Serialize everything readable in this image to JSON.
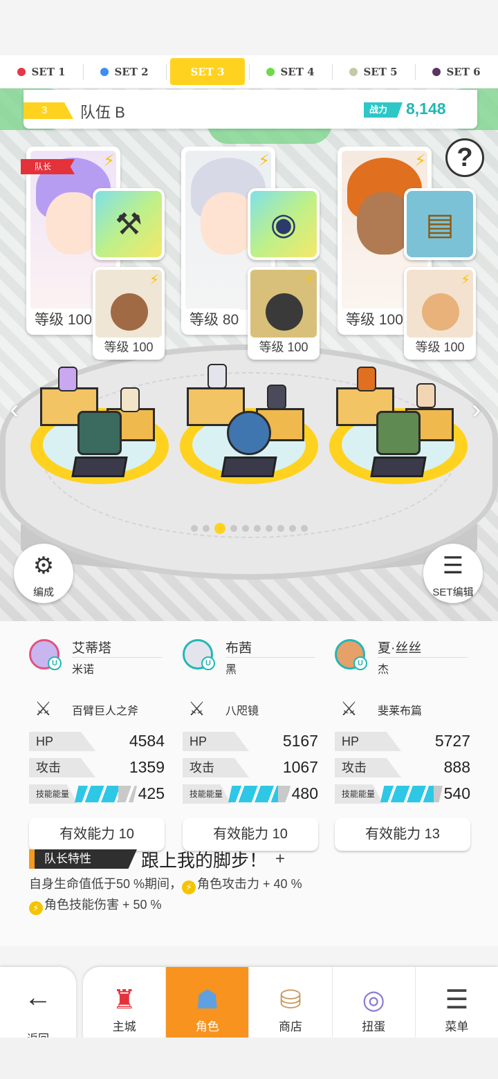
{
  "set_tabs": [
    {
      "label": "SET 1",
      "color": "#e7364a",
      "active": false
    },
    {
      "label": "SET 2",
      "color": "#3c8ef0",
      "active": false
    },
    {
      "label": "SET 3",
      "color": "#ffd21f",
      "active": true
    },
    {
      "label": "SET 4",
      "color": "#6fd94a",
      "active": false
    },
    {
      "label": "SET 5",
      "color": "#c4c9a6",
      "active": false
    },
    {
      "label": "SET 6",
      "color": "#5b3466",
      "active": false
    }
  ],
  "team": {
    "number": "3",
    "name": "队伍 B",
    "power_label": "战力",
    "power_value": "8,148"
  },
  "leader_tag": "队长",
  "heroes": [
    {
      "level": "等级 100",
      "sub_level": "等级 100"
    },
    {
      "level": "等级 80",
      "sub_level": "等级 100"
    },
    {
      "level": "等级 100",
      "sub_level": "等级 100"
    }
  ],
  "help_glyph": "?",
  "pager": {
    "count": 10,
    "active_index": 2
  },
  "buttons": {
    "formation_label": "编成",
    "set_edit_label": "SET编辑"
  },
  "stats": [
    {
      "name": "艾蒂塔",
      "partner": "米诺",
      "weapon": "百臂巨人之斧",
      "hp_label": "HP",
      "hp": "4584",
      "atk_label": "攻击",
      "atk": "1359",
      "energy_label": "技能能量",
      "energy": "425",
      "effective": "有效能力 10"
    },
    {
      "name": "布茜",
      "partner": "黑",
      "weapon": "八咫镜",
      "hp_label": "HP",
      "hp": "5167",
      "atk_label": "攻击",
      "atk": "1067",
      "energy_label": "技能能量",
      "energy": "480",
      "effective": "有效能力 10"
    },
    {
      "name": "夏·丝丝",
      "partner": "杰",
      "weapon": "斐莱布篇",
      "hp_label": "HP",
      "hp": "5727",
      "atk_label": "攻击",
      "atk": "888",
      "energy_label": "技能能量",
      "energy": "540",
      "effective": "有效能力 13"
    }
  ],
  "leader": {
    "label": "队长特性",
    "title": "跟上我的脚步！",
    "plus": "+",
    "desc_line1_a": "自身生命值低于50 %期间，",
    "desc_line1_b": "角色攻击力 + 40 %",
    "desc_line2": "角色技能伤害 + 50 %"
  },
  "nav": {
    "back_label": "返回",
    "tabs": [
      "主城",
      "角色",
      "商店",
      "扭蛋",
      "菜单"
    ],
    "active": "角色"
  }
}
